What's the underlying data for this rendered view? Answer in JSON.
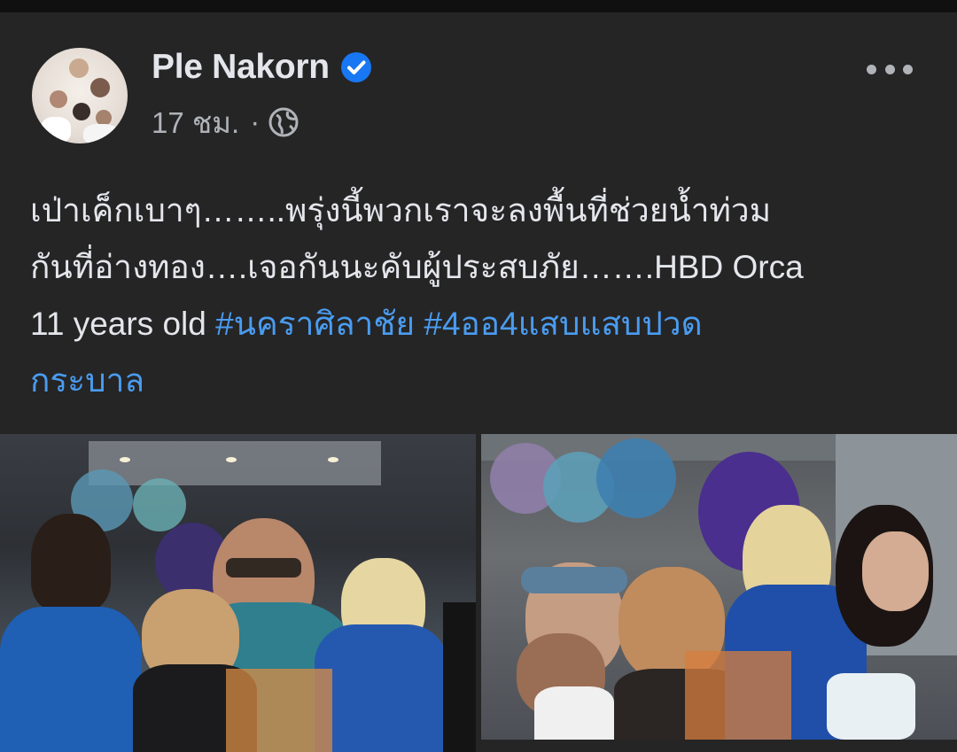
{
  "post": {
    "author": "Ple Nakorn",
    "time": "17 ชม.",
    "separator": "·",
    "icons": {
      "verified": "verified-badge-icon",
      "audience": "globe-icon",
      "more": "more-options-icon"
    },
    "text_lines": [
      "เป่าเค็กเบาๆ……..พรุ่งนี้พวกเราจะลงพื้นที่ช่วยน้ำท่วม",
      "กันที่อ่างทอง….เจอกันนะคับผู้ประสบภัย…….HBD Orca"
    ],
    "text_line3_plain": "11 years old ",
    "hashtag1": "#นคราศิลาชัย",
    "hashtag2_part1": "#4ออ4แสบแสบปวด",
    "hashtag2_part2": "กระบาล"
  },
  "colors": {
    "background": "#252526",
    "text": "#e4e6eb",
    "secondary_text": "#b0b3b8",
    "hashtag": "#4a9cf0",
    "verified": "#1877f2"
  }
}
